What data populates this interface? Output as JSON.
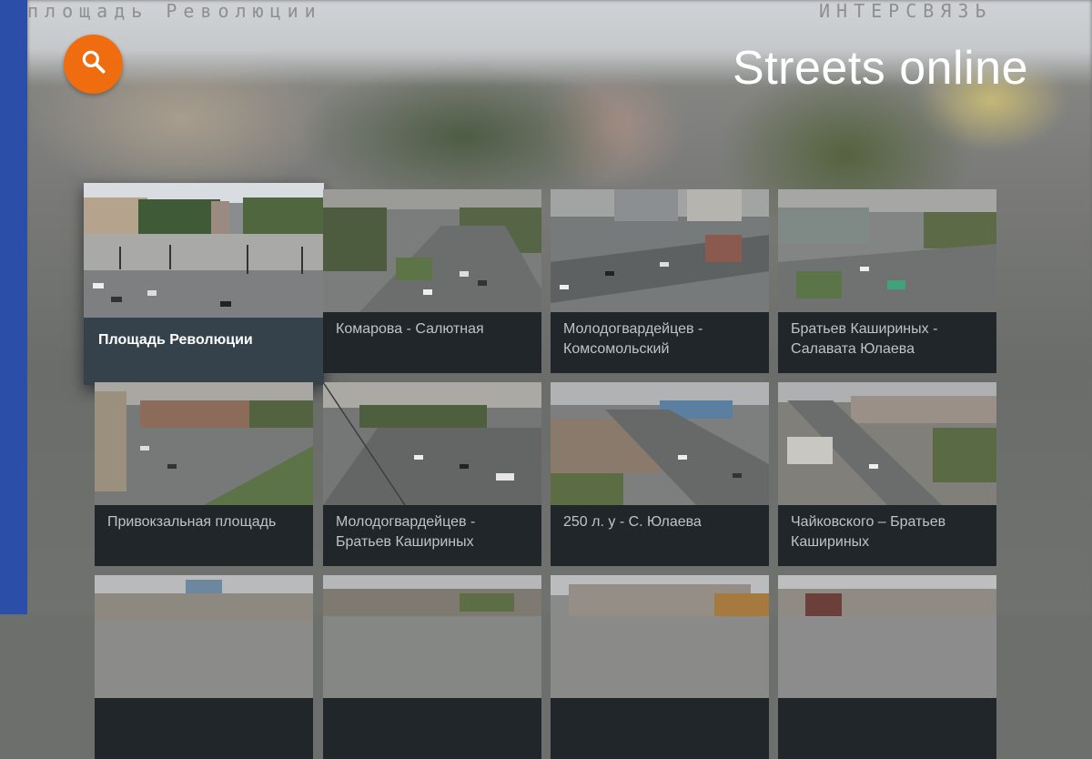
{
  "app": {
    "title": "Streets online",
    "search_icon": "search-icon"
  },
  "background": {
    "left_caption": "площадь Революции",
    "right_caption": "ИНТЕРСВЯЗЬ"
  },
  "colors": {
    "accent": "#ef6c0f",
    "side_bar": "#2b4fa8",
    "card_bg": "#21262b",
    "focused_card_bg": "#35424b"
  },
  "cameras": [
    {
      "label": "Площадь Революции",
      "focused": true
    },
    {
      "label": "Комарова - Салютная"
    },
    {
      "label": "Молодогвардейцев - Комсомольский"
    },
    {
      "label": "Братьев Кашириных - Салавата Юлаева"
    },
    {
      "label": "Привокзальная площадь"
    },
    {
      "label": "Молодогвардейцев - Братьев Кашириных"
    },
    {
      "label": "250 л. у - С. Юлаева"
    },
    {
      "label": "Чайковского – Братьев Кашириных"
    },
    {
      "label": ""
    },
    {
      "label": ""
    },
    {
      "label": ""
    },
    {
      "label": ""
    }
  ]
}
